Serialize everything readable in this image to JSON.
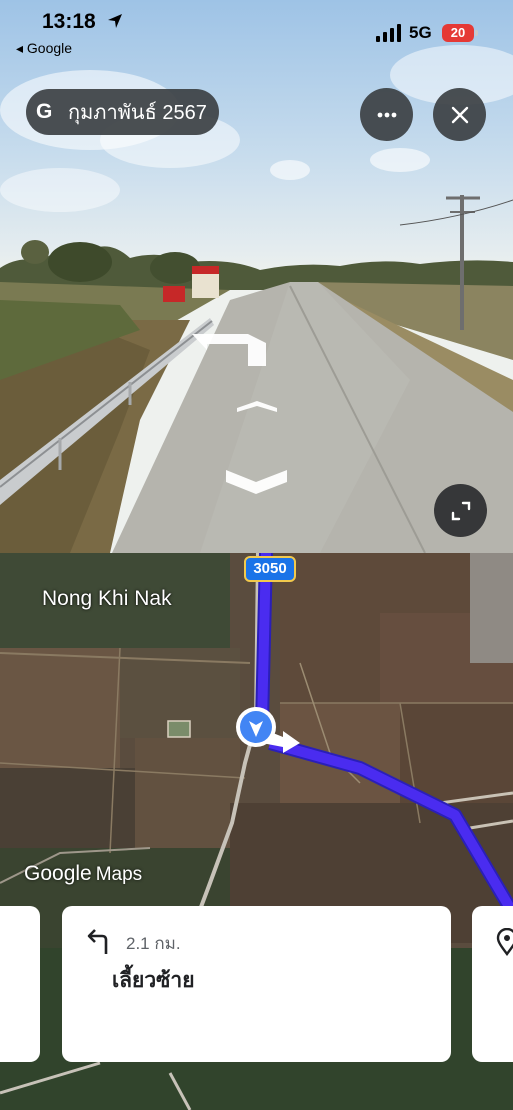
{
  "status_bar": {
    "time": "13:18",
    "back_label": "◂ Google",
    "network": "5G",
    "battery": "20",
    "battery_color": "#e53935"
  },
  "street_view": {
    "date_label": "กุมภาพันธ์ 2567",
    "brand_letter": "G",
    "buttons": [
      "more-icon",
      "close-icon",
      "expand-icon"
    ]
  },
  "map": {
    "place_label": "Nong Khi Nak",
    "road_number": "3050",
    "logo_google": "Google",
    "logo_maps": "Maps",
    "route_color": "#4a2cf0"
  },
  "navigation": {
    "distance": "2.1 กม.",
    "instruction": "เลี้ยวซ้าย",
    "icons": [
      "turn-left-icon",
      "place-pin-icon"
    ]
  }
}
